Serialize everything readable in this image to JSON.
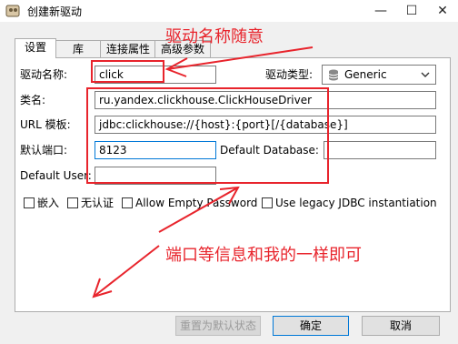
{
  "window": {
    "title": "创建新驱动",
    "minimize": "—",
    "maximize": "☐",
    "close": "✕"
  },
  "tabs": [
    {
      "label": "设置",
      "active": true
    },
    {
      "label": "库",
      "active": false
    },
    {
      "label": "连接属性",
      "active": false
    },
    {
      "label": "高级参数",
      "active": false
    }
  ],
  "form": {
    "driver_name_label": "驱动名称:",
    "driver_name_value": "click",
    "driver_type_label": "驱动类型:",
    "driver_type_value": "Generic",
    "class_name_label": "类名:",
    "class_name_value": "ru.yandex.clickhouse.ClickHouseDriver",
    "url_template_label": "URL 模板:",
    "url_template_value": "jdbc:clickhouse://{host}:{port}[/{database}]",
    "default_port_label": "默认端口:",
    "default_port_value": "8123",
    "default_database_label": "Default Database:",
    "default_database_value": "",
    "default_user_label": "Default User:",
    "default_user_value": ""
  },
  "options": [
    {
      "label": "嵌入",
      "checked": false
    },
    {
      "label": "无认证",
      "checked": false
    },
    {
      "label": "Allow Empty Password",
      "checked": false
    },
    {
      "label": "Use legacy JDBC instantiation",
      "checked": false
    }
  ],
  "buttons": {
    "reset": "重置为默认状态",
    "ok": "确定",
    "cancel": "取消"
  },
  "annotations": {
    "top_note": "驱动名称随意",
    "bottom_note": "端口等信息和我的一样即可",
    "color": "#e8242c"
  }
}
